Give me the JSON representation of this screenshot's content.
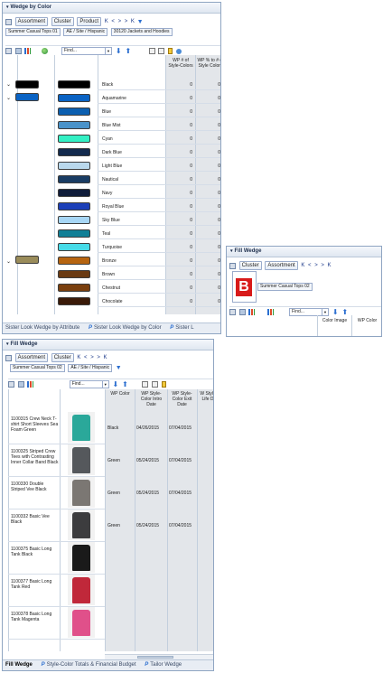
{
  "wedge_by_color": {
    "title": "Wedge by Color",
    "toolbar_buttons": [
      "Assortment",
      "Cluster",
      "Product"
    ],
    "nav": "K < > > K",
    "breadcrumbs": [
      "Summer Casual Tops 01",
      "AE / Site / Hispanic",
      "30120 Jackets and Hoodies"
    ],
    "find_placeholder": "Find...",
    "col_headers": [
      "WP # of Style-Colors",
      "WP % to # of Style Colors"
    ],
    "rows": [
      {
        "color": "Black",
        "swatch": "#000000",
        "wp": "0",
        "pct": "0"
      },
      {
        "color": "Aquamarine",
        "swatch": "#0a63c4",
        "wp": "0",
        "pct": "0"
      },
      {
        "color": "Blue",
        "swatch": "#0b5fb0",
        "wp": "0",
        "pct": "0"
      },
      {
        "color": "Blue Mist",
        "swatch": "#4a93c9",
        "wp": "0",
        "pct": "0"
      },
      {
        "color": "Cyan",
        "swatch": "#33f0c4",
        "wp": "0",
        "pct": "0"
      },
      {
        "color": "Dark Blue",
        "swatch": "#132a4e",
        "wp": "0",
        "pct": "0"
      },
      {
        "color": "Light Blue",
        "swatch": "#b9d8ec",
        "wp": "0",
        "pct": "0"
      },
      {
        "color": "Nautical",
        "swatch": "#1a3c63",
        "wp": "0",
        "pct": "0"
      },
      {
        "color": "Navy",
        "swatch": "#101d3a",
        "wp": "0",
        "pct": "0"
      },
      {
        "color": "Royal Blue",
        "swatch": "#1c3fb8",
        "wp": "0",
        "pct": "0"
      },
      {
        "color": "Sky Blue",
        "swatch": "#a7d6f5",
        "wp": "0",
        "pct": "0"
      },
      {
        "color": "Teal",
        "swatch": "#117f96",
        "wp": "0",
        "pct": "0"
      },
      {
        "color": "Turquoise",
        "swatch": "#46dbe8",
        "wp": "0",
        "pct": "0"
      },
      {
        "color": "Bronze",
        "swatch": "#b66410",
        "wp": "0",
        "pct": "0"
      },
      {
        "color": "Brown",
        "swatch": "#6a3a12",
        "wp": "0",
        "pct": "0"
      },
      {
        "color": "Chestnut",
        "swatch": "#7a3f0e",
        "wp": "0",
        "pct": "0"
      },
      {
        "color": "Chocolate",
        "swatch": "#3a1a08",
        "wp": "0",
        "pct": "0"
      }
    ],
    "group_swatches": [
      "#000000",
      "#0a63c4",
      "#9a8c5a"
    ],
    "tabs": [
      "Sister Look Wedge by Attribute",
      "Sister Look Wedge by Color",
      "Sister L"
    ]
  },
  "fill_wedge_small": {
    "title": "Fill Wedge",
    "toolbar_buttons": [
      "Cluster",
      "Assortment"
    ],
    "nav": "K < > > K",
    "breadcrumb": "Summer Casual Tops 02",
    "logo_letter": "B",
    "find_placeholder": "Find...",
    "col_headers": [
      "Color Image",
      "WP Color"
    ]
  },
  "fill_wedge": {
    "title": "Fill Wedge",
    "toolbar_buttons": [
      "Assortment",
      "Cluster"
    ],
    "nav": "K < > > K",
    "breadcrumbs": [
      "Summer Casual Tops 02",
      "AE / Site / Hispanic"
    ],
    "find_placeholder": "Find...",
    "col_headers": [
      "WP Color",
      "WP Style-Color Intro Date",
      "WP Style-Color Exit Date",
      "W Style Life D"
    ],
    "rows": [
      {
        "name": "1100315 Crew Neck T-shirt Short Sleeves Sea Foam Green",
        "color": "Black",
        "intro": "04/26/2015",
        "exit": "07/04/2015",
        "shirt": "#2aa89a"
      },
      {
        "name": "1100325 Striped Crew Tees with Contrasting Inner Collar Band Black",
        "color": "Green",
        "intro": "05/24/2015",
        "exit": "07/04/2015",
        "shirt": "#55585c"
      },
      {
        "name": "1100330 Double Striped Vee Black",
        "color": "Green",
        "intro": "05/24/2015",
        "exit": "07/04/2015",
        "shirt": "#7b7773"
      },
      {
        "name": "1100332 Basic Vee Black",
        "color": "Green",
        "intro": "05/24/2015",
        "exit": "07/04/2015",
        "shirt": "#3c3c3e"
      },
      {
        "name": "1100375 Basic Long Tank Black",
        "color": "",
        "intro": "",
        "exit": "",
        "shirt": "#1a1a1a"
      },
      {
        "name": "1100377 Basic Long Tank Red",
        "color": "",
        "intro": "",
        "exit": "",
        "shirt": "#c0283a"
      },
      {
        "name": "1100378 Basic Long Tank Magenta",
        "color": "",
        "intro": "",
        "exit": "",
        "shirt": "#e0508a"
      }
    ],
    "tabs": [
      "Fill Wedge",
      "Style-Color Totals & Financial Budget",
      "Tailor Wedge"
    ]
  }
}
